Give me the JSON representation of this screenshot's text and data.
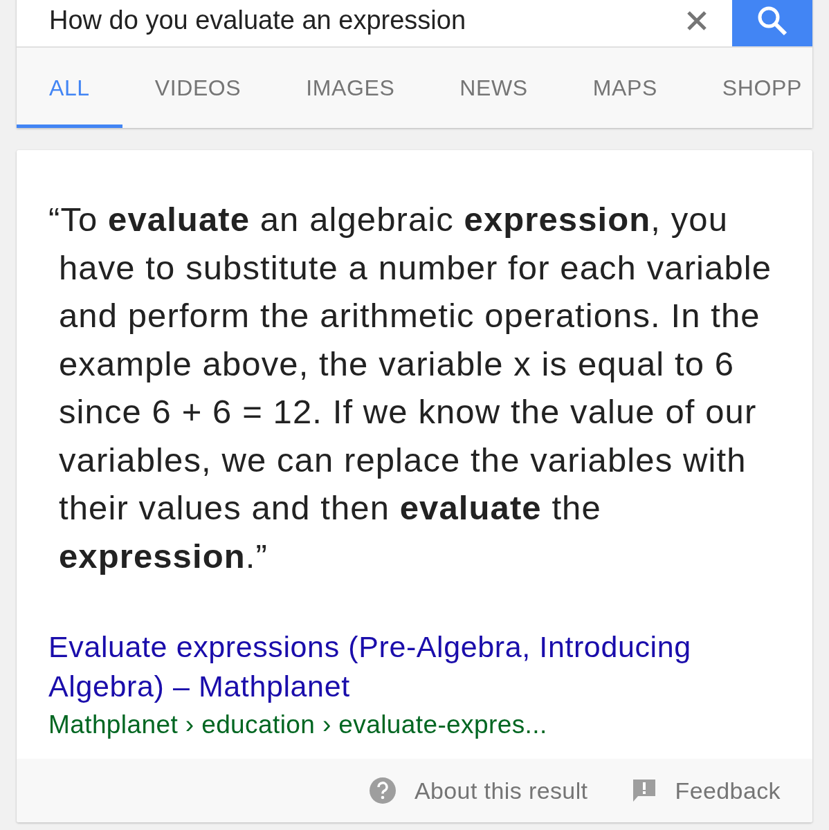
{
  "search": {
    "value": "How do you evaluate an expression"
  },
  "tabs": [
    {
      "label": "ALL",
      "selected": true
    },
    {
      "label": "VIDEOS",
      "selected": false
    },
    {
      "label": "IMAGES",
      "selected": false
    },
    {
      "label": "NEWS",
      "selected": false
    },
    {
      "label": "MAPS",
      "selected": false
    },
    {
      "label": "SHOPP",
      "selected": false
    }
  ],
  "answer": {
    "quote": "“To **evaluate** an algebraic **expression**, you have to substitute a number for each variable and perform the arithmetic operations. In the example above, the variable x is equal to 6 since 6 + 6 = 12. If we know the value of our variables, we can replace the variables with their values and then **evaluate** the **expression**.”",
    "link_title": "Evaluate expressions (Pre-Algebra, Introducing Algebra) – Mathplanet",
    "breadcrumb": "Mathplanet › education › evaluate-expres..."
  },
  "footer": {
    "about": "About this result",
    "feedback": "Feedback"
  }
}
